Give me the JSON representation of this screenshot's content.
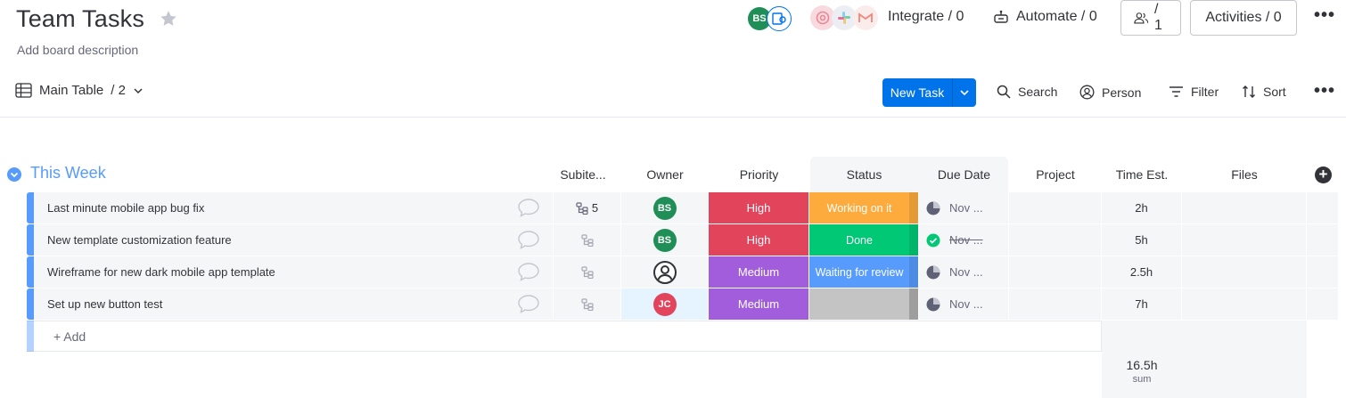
{
  "board": {
    "title": "Team Tasks",
    "description": "Add board description"
  },
  "header": {
    "members": [
      {
        "initials": "BS",
        "color": "#1f8f57"
      }
    ],
    "integrate_label": "Integrate / 0",
    "automate_label": "Automate / 0",
    "invite_count": "/ 1",
    "activities_label": "Activities / 0"
  },
  "toolbar": {
    "view_label": "Main Table",
    "view_count": "/ 2",
    "new_task_label": "New Task",
    "search_label": "Search",
    "person_label": "Person",
    "filter_label": "Filter",
    "sort_label": "Sort"
  },
  "group": {
    "title": "This Week",
    "color": "#579bfc",
    "columns": {
      "subitems": "Subite...",
      "owner": "Owner",
      "priority": "Priority",
      "status": "Status",
      "due_date": "Due Date",
      "project": "Project",
      "time_est": "Time Est.",
      "files": "Files"
    },
    "add_label": "+ Add",
    "sum_value": "16.5h",
    "sum_label": "sum"
  },
  "rows": [
    {
      "name": "Last minute mobile app bug fix",
      "subitems": "5",
      "owner": {
        "initials": "BS",
        "color": "#1f8f57",
        "type": "initials"
      },
      "priority": {
        "label": "High",
        "color": "#e2445c"
      },
      "status": {
        "label": "Working on it",
        "color": "#fdab3d",
        "fold": "#fdab3d"
      },
      "due": {
        "label": "Nov ...",
        "state": "pending"
      },
      "time": "2h"
    },
    {
      "name": "New template customization feature",
      "subitems": "",
      "owner": {
        "initials": "BS",
        "color": "#1f8f57",
        "type": "initials"
      },
      "priority": {
        "label": "High",
        "color": "#e2445c"
      },
      "status": {
        "label": "Done",
        "color": "#00c875",
        "fold": "#00c875"
      },
      "due": {
        "label": "Nov ...",
        "state": "done"
      },
      "time": "5h"
    },
    {
      "name": "Wireframe for new dark mobile app template",
      "subitems": "",
      "owner": {
        "initials": "",
        "color": "#323338",
        "type": "person"
      },
      "priority": {
        "label": "Medium",
        "color": "#a25ddc"
      },
      "status": {
        "label": "Waiting for review",
        "color": "#579bfc",
        "fold": "#579bfc"
      },
      "due": {
        "label": "Nov ...",
        "state": "pending"
      },
      "time": "2.5h"
    },
    {
      "name": "Set up new button test",
      "subitems": "",
      "owner": {
        "initials": "JC",
        "color": "#e2445c",
        "type": "initials"
      },
      "priority": {
        "label": "Medium",
        "color": "#a25ddc"
      },
      "status": {
        "label": "",
        "color": "#c4c4c4",
        "fold": "#b0b0b0"
      },
      "due": {
        "label": "Nov ...",
        "state": "pending"
      },
      "time": "7h"
    }
  ]
}
